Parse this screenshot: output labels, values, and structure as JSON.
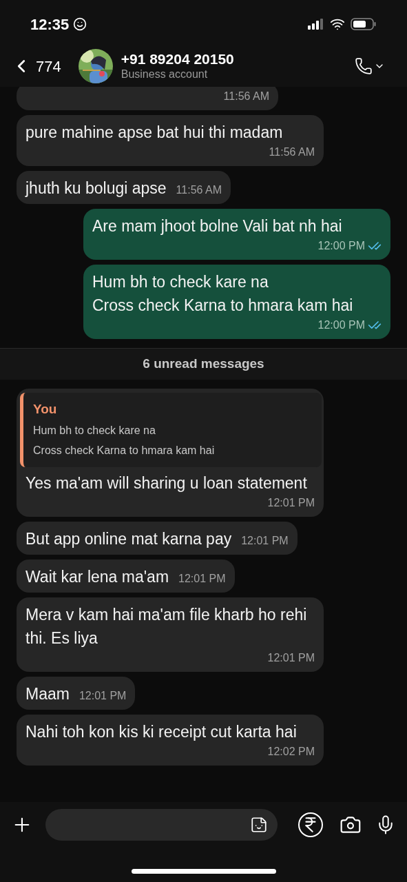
{
  "status_bar": {
    "time": "12:35"
  },
  "header": {
    "back_count": "774",
    "name": "+91 89204 20150",
    "subtitle": "Business account"
  },
  "messages": [
    {
      "kind": "incoming",
      "time": "11:56 AM"
    },
    {
      "kind": "incoming",
      "text": "pure mahine apse bat hui thi madam",
      "time": "11:56 AM"
    },
    {
      "kind": "incoming",
      "text": "jhuth ku bolugi apse",
      "time": "11:56 AM"
    },
    {
      "kind": "outgoing",
      "text": "Are mam jhoot bolne Vali bat nh hai",
      "time": "12:00 PM",
      "read": true
    },
    {
      "kind": "outgoing",
      "text": "Hum bh to check kare na\nCross check Karna to hmara kam hai",
      "time": "12:00 PM",
      "read": true
    },
    {
      "kind": "divider",
      "text": "6 unread messages"
    },
    {
      "kind": "incoming",
      "reply": {
        "author": "You",
        "text": "Hum bh to check kare na\nCross check Karna to hmara kam hai"
      },
      "text": "Yes ma'am will sharing u loan statement",
      "time": "12:01 PM"
    },
    {
      "kind": "incoming",
      "text": "But app online mat karna pay",
      "time": "12:01 PM"
    },
    {
      "kind": "incoming",
      "text": "Wait kar lena ma'am",
      "time": "12:01 PM"
    },
    {
      "kind": "incoming",
      "text": "Mera v kam hai ma'am file kharb ho rehi thi. Es liya",
      "time": "12:01 PM"
    },
    {
      "kind": "incoming",
      "text": "Maam",
      "time": "12:01 PM"
    },
    {
      "kind": "incoming",
      "text": "Nahi toh kon kis ki receipt cut karta hai",
      "time": "12:02 PM"
    }
  ]
}
